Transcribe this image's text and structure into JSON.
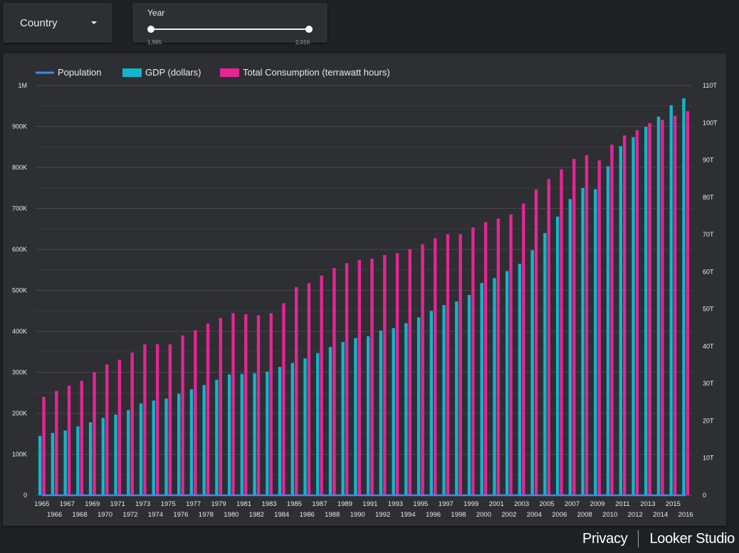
{
  "controls": {
    "country_label": "Country",
    "year": {
      "title": "Year",
      "min_label": "1,965",
      "max_label": "2,016",
      "min": 1965,
      "max": 2016
    }
  },
  "footer": {
    "privacy": "Privacy",
    "brand": "Looker Studio"
  },
  "colors": {
    "population": "#4285f4",
    "gdp": "#12b5cb",
    "consumption": "#e52592",
    "background": "#202124",
    "panel": "#2d2f33"
  },
  "chart_data": {
    "type": "bar",
    "x": [
      1965,
      1966,
      1967,
      1968,
      1969,
      1970,
      1971,
      1972,
      1973,
      1974,
      1975,
      1976,
      1977,
      1978,
      1979,
      1980,
      1981,
      1982,
      1983,
      1984,
      1985,
      1986,
      1987,
      1988,
      1989,
      1990,
      1991,
      1992,
      1993,
      1994,
      1995,
      1996,
      1997,
      1998,
      1999,
      2000,
      2001,
      2002,
      2003,
      2004,
      2005,
      2006,
      2007,
      2008,
      2009,
      2010,
      2011,
      2012,
      2013,
      2014,
      2015,
      2016
    ],
    "series": [
      {
        "name": "Population",
        "type": "line",
        "axis": "left",
        "values": [
          0,
          0,
          0,
          0,
          0,
          0,
          0,
          0,
          0,
          0,
          0,
          0,
          0,
          0,
          0,
          0,
          0,
          0,
          0,
          0,
          0,
          0,
          0,
          0,
          0,
          0,
          0,
          0,
          0,
          0,
          0,
          0,
          0,
          0,
          0,
          0,
          0,
          0,
          0,
          0,
          0,
          0,
          0,
          0,
          0,
          0,
          0,
          0,
          0,
          0,
          0,
          0
        ]
      },
      {
        "name": "GDP (dollars)",
        "type": "bar",
        "axis": "left",
        "values": [
          145000,
          152000,
          158000,
          168000,
          178000,
          189000,
          197000,
          208000,
          224000,
          231000,
          236000,
          248000,
          259000,
          269000,
          282000,
          295000,
          296000,
          298000,
          302000,
          313000,
          323000,
          334000,
          347000,
          362000,
          374000,
          384000,
          388000,
          402000,
          408000,
          420000,
          434000,
          450000,
          464000,
          473000,
          489000,
          518000,
          530000,
          547000,
          565000,
          598000,
          640000,
          680000,
          723000,
          750000,
          747000,
          803000,
          852000,
          874000,
          899000,
          924000,
          952000,
          969000
        ]
      },
      {
        "name": "Total Consumption (terrawatt hours)",
        "type": "bar",
        "axis": "right",
        "values": [
          26.4,
          28.0,
          29.4,
          30.7,
          33.0,
          35.1,
          36.4,
          38.3,
          40.5,
          40.5,
          40.5,
          42.9,
          44.3,
          46.1,
          47.6,
          48.9,
          48.6,
          48.3,
          48.9,
          51.6,
          55.9,
          56.9,
          59.0,
          61.0,
          62.3,
          63.2,
          63.5,
          64.5,
          65.0,
          66.1,
          67.4,
          69.0,
          70.1,
          70.1,
          71.9,
          73.3,
          74.3,
          75.4,
          78.3,
          82.1,
          84.9,
          87.5,
          90.3,
          91.3,
          89.9,
          94.1,
          96.6,
          98.0,
          99.9,
          100.8,
          101.9,
          103.1
        ]
      }
    ],
    "left_axis": {
      "ylim": [
        0,
        1000000
      ],
      "ticks": [
        "0",
        "100K",
        "200K",
        "300K",
        "400K",
        "500K",
        "600K",
        "700K",
        "800K",
        "900K",
        "1M"
      ]
    },
    "right_axis": {
      "ylim": [
        0,
        110
      ],
      "ticks": [
        "0",
        "10T",
        "20T",
        "30T",
        "40T",
        "50T",
        "60T",
        "70T",
        "80T",
        "90T",
        "100T",
        "110T"
      ]
    },
    "legend_position": "top-left",
    "grid": true
  }
}
